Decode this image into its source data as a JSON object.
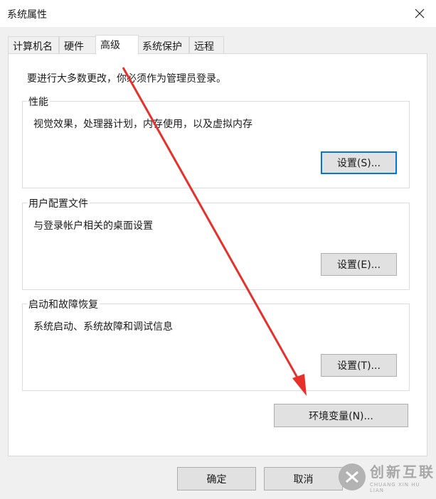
{
  "window": {
    "title": "系统属性"
  },
  "tabs": [
    {
      "label": "计算机名"
    },
    {
      "label": "硬件"
    },
    {
      "label": "高级"
    },
    {
      "label": "系统保护"
    },
    {
      "label": "远程"
    }
  ],
  "panel": {
    "admin_note": "要进行大多数更改，你必须作为管理员登录。",
    "performance": {
      "label": "性能",
      "desc": "视觉效果，处理器计划，内存使用，以及虚拟内存",
      "button": "设置(S)..."
    },
    "user_profiles": {
      "label": "用户配置文件",
      "desc": "与登录帐户相关的桌面设置",
      "button": "设置(E)..."
    },
    "startup_recovery": {
      "label": "启动和故障恢复",
      "desc": "系统启动、系统故障和调试信息",
      "button": "设置(T)..."
    },
    "env_button": "环境变量(N)..."
  },
  "footer": {
    "ok": "确定",
    "cancel": "取消"
  },
  "watermark": {
    "text": "创新互联",
    "sub": "CHUANG XIN HU LIAN"
  },
  "colors": {
    "annotation_arrow": "#e8302a",
    "focus_border": "#0078d7"
  },
  "icons": {
    "close": "close-icon",
    "watermark_logo": "brand-logo-icon"
  }
}
